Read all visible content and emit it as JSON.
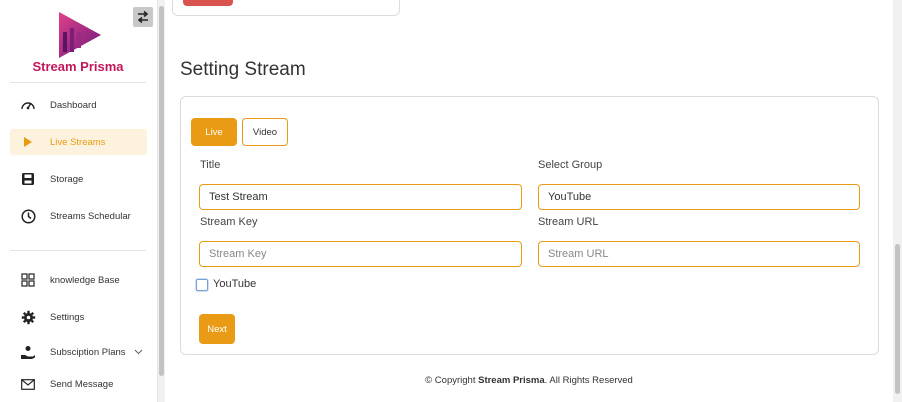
{
  "sidebar": {
    "brand": "Stream Prisma",
    "accent": "#e99b16",
    "brand_color": "#c2185b",
    "items": [
      {
        "label": "Dashboard",
        "icon": "gauge-icon"
      },
      {
        "label": "Live Streams",
        "icon": "play-icon",
        "active": true
      },
      {
        "label": "Storage",
        "icon": "floppy-icon"
      },
      {
        "label": "Streams Schedular",
        "icon": "clock-icon"
      },
      {
        "label": "knowledge Base",
        "icon": "grid-icon"
      },
      {
        "label": "Settings",
        "icon": "gear-icon"
      },
      {
        "label": "Subsciption Plans",
        "icon": "hand-coin-icon"
      },
      {
        "label": "Send Message",
        "icon": "envelope-icon"
      }
    ]
  },
  "main": {
    "page_title": "Setting Stream",
    "tabs": [
      {
        "label": "Live",
        "active": true
      },
      {
        "label": "Video",
        "active": false
      }
    ],
    "form": {
      "title_label": "Title",
      "title_value": "Test Stream",
      "group_label": "Select Group",
      "group_value": "YouTube",
      "key_label": "Stream Key",
      "key_placeholder": "Stream Key",
      "url_label": "Stream URL",
      "url_placeholder": "Stream URL",
      "checkbox_label": "YouTube",
      "next_label": "Next"
    },
    "footer": {
      "prefix": "© Copyright",
      "brand": "Stream Prisma",
      "suffix": ". All Rights Reserved"
    }
  }
}
